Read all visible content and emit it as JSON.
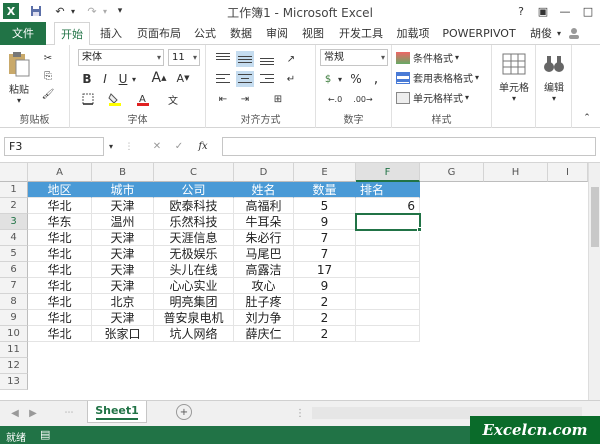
{
  "title": "工作簿1 - Microsoft Excel",
  "user": "胡俊",
  "tabs": [
    {
      "label": "文件"
    },
    {
      "label": "开始"
    },
    {
      "label": "插入"
    },
    {
      "label": "页面布局"
    },
    {
      "label": "公式"
    },
    {
      "label": "数据"
    },
    {
      "label": "审阅"
    },
    {
      "label": "视图"
    },
    {
      "label": "开发工具"
    },
    {
      "label": "加载项"
    },
    {
      "label": "POWERPIVOT"
    }
  ],
  "ribbon": {
    "paste": "粘贴",
    "clipboard": "剪贴板",
    "font_name": "宋体",
    "font_size": "11",
    "font_group": "字体",
    "align_group": "对齐方式",
    "number_format": "常规",
    "number_group": "数字",
    "cond_format": "条件格式",
    "table_format": "套用表格格式",
    "cell_style": "单元格样式",
    "style_group": "样式",
    "cells": "单元格",
    "edit": "编辑",
    "bold": "B",
    "italic": "I",
    "underline": "U",
    "percent": "%",
    "comma": ","
  },
  "formula_bar": {
    "name_box": "F3",
    "fx": "fx",
    "formula": ""
  },
  "columns": [
    "A",
    "B",
    "C",
    "D",
    "E",
    "F",
    "G",
    "H",
    "I"
  ],
  "rows": [
    "1",
    "2",
    "3",
    "4",
    "5",
    "6",
    "7",
    "8",
    "9",
    "10",
    "11",
    "12",
    "13"
  ],
  "sheet": {
    "header": [
      "地区",
      "城市",
      "公司",
      "姓名",
      "数量",
      "排名"
    ],
    "data": [
      [
        "华北",
        "天津",
        "欧泰科技",
        "高福利",
        "5",
        "6"
      ],
      [
        "华东",
        "温州",
        "乐然科技",
        "牛耳朵",
        "9",
        ""
      ],
      [
        "华北",
        "天津",
        "天涯信息",
        "朱必行",
        "7",
        ""
      ],
      [
        "华北",
        "天津",
        "无极娱乐",
        "马尾巴",
        "7",
        ""
      ],
      [
        "华北",
        "天津",
        "头儿在线",
        "高露洁",
        "17",
        ""
      ],
      [
        "华北",
        "天津",
        "心心实业",
        "攻心",
        "9",
        ""
      ],
      [
        "华北",
        "北京",
        "明亮集团",
        "肚子疼",
        "2",
        ""
      ],
      [
        "华北",
        "天津",
        "普安泉电机",
        "刘力争",
        "2",
        ""
      ],
      [
        "华北",
        "张家口",
        "坑人网络",
        "薛庆仁",
        "2",
        ""
      ]
    ]
  },
  "sheet_tab": "Sheet1",
  "status": "就绪",
  "watermark": "Excelcn.com",
  "colors": {
    "accent": "#217346",
    "header_fill": "#4a9ad6"
  }
}
